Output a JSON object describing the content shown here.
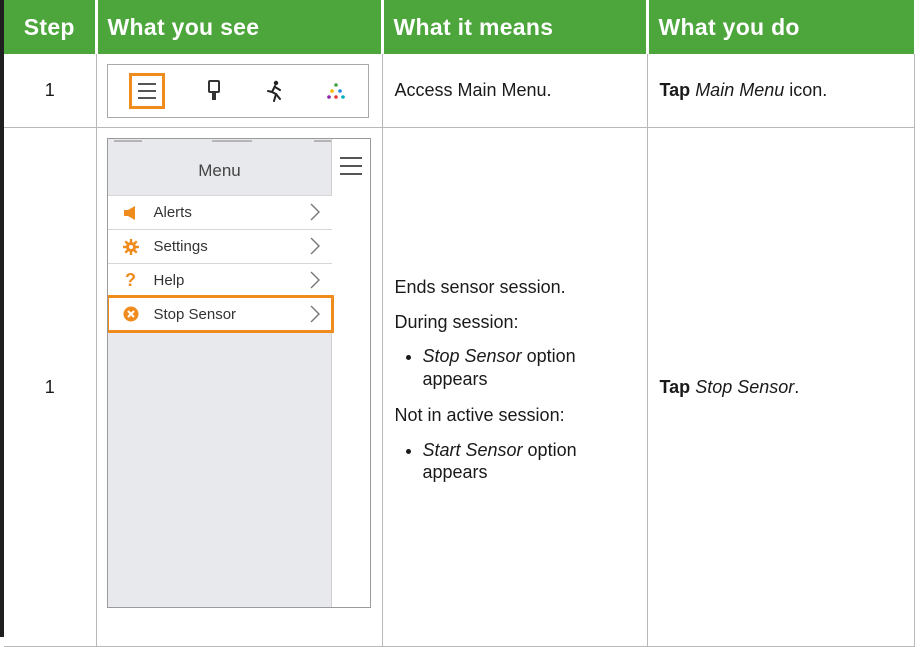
{
  "header": {
    "step": "Step",
    "see": "What you see",
    "means": "What it means",
    "do": "What you do"
  },
  "colors": {
    "header_green": "#4ca63c",
    "highlight_orange": "#f08c1e"
  },
  "rows": [
    {
      "step": "1",
      "see": {
        "icons": [
          "main-menu-icon",
          "sensor-icon",
          "activity-icon",
          "dots-icon"
        ]
      },
      "means": "Access Main Menu.",
      "do": {
        "bold": "Tap",
        "italic": "Main Menu",
        "rest": " icon."
      }
    },
    {
      "step": "1",
      "see": {
        "menu_title": "Menu",
        "items": [
          {
            "label": "Alerts",
            "icon": "speaker-icon"
          },
          {
            "label": "Settings",
            "icon": "gear-icon"
          },
          {
            "label": "Help",
            "icon": "question-icon"
          },
          {
            "label": "Stop Sensor",
            "icon": "stop-icon"
          }
        ]
      },
      "means": {
        "line1": "Ends sensor session.",
        "line2": "During session:",
        "bullet1_italic": "Stop Sensor",
        "bullet1_rest": " option appears",
        "line3": "Not in active session:",
        "bullet2_italic": "Start Sensor",
        "bullet2_rest": " option appears"
      },
      "do": {
        "bold": "Tap",
        "italic": "Stop Sensor",
        "rest": "."
      }
    }
  ]
}
